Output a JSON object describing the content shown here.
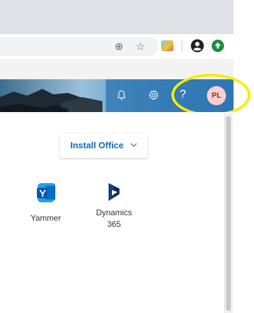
{
  "browser": {
    "icons": [
      "zoom-icon",
      "bookmark-star-icon",
      "extension-icon",
      "account-icon",
      "update-icon"
    ],
    "colors": {
      "tabstrip": "#dee1e6",
      "omnibox": "#f1f3f4",
      "update": "#1e8e3e"
    }
  },
  "header": {
    "icons": [
      "notification-bell-icon",
      "settings-gear-icon",
      "help-icon"
    ],
    "help_label": "?",
    "avatar_initials": "PL"
  },
  "main": {
    "install_office_label": "Install Office",
    "apps": [
      {
        "name": "Yammer",
        "icon": "yammer-icon"
      },
      {
        "name_line1": "Dynamics",
        "name_line2": "365",
        "icon": "dynamics-365-icon"
      }
    ]
  },
  "annotation": {
    "highlight_color": "#f5ee00"
  }
}
